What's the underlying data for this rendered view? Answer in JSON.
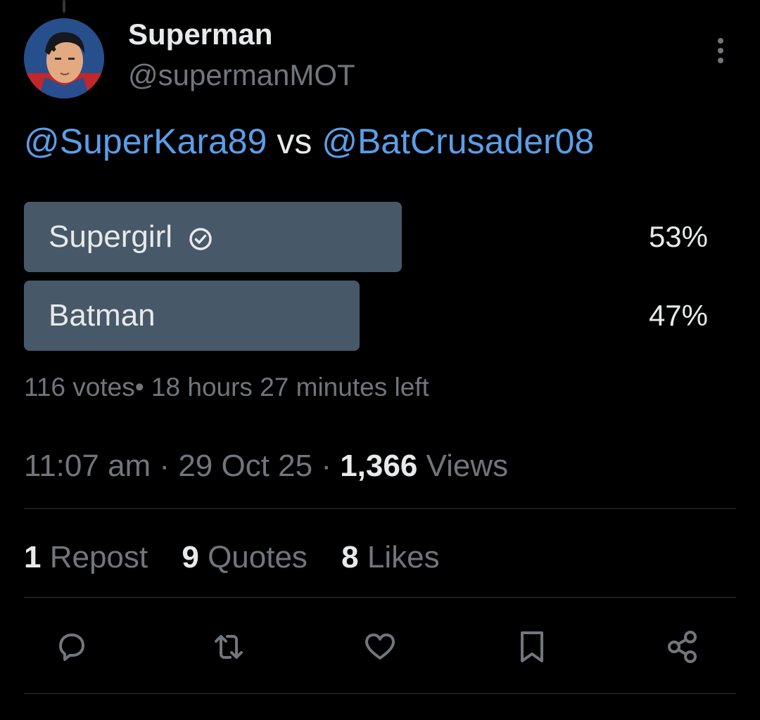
{
  "author": {
    "display_name": "Superman",
    "handle": "@supermanMOT"
  },
  "tweet": {
    "mention_1": "@SuperKara89",
    "connector": " vs ",
    "mention_2": "@BatCrusader08"
  },
  "poll": {
    "options": [
      {
        "label": "Supergirl",
        "percent_text": "53%",
        "fraction": 0.53,
        "selected": true
      },
      {
        "label": "Batman",
        "percent_text": "47%",
        "fraction": 0.47,
        "selected": false
      }
    ],
    "votes_text": "116 votes",
    "time_left_text": "• 18 hours 27 minutes left"
  },
  "meta": {
    "time": "11:07 am",
    "separator": " · ",
    "date": "29 Oct 25",
    "views_count": "1,366",
    "views_label": " Views"
  },
  "stats": {
    "reposts_count": "1",
    "reposts_label": " Repost",
    "quotes_count": "9",
    "quotes_label": " Quotes",
    "likes_count": "8",
    "likes_label": " Likes"
  },
  "icons": {
    "more": "more-vertical-icon",
    "reply": "reply-icon",
    "repost": "repost-icon",
    "like": "heart-icon",
    "bookmark": "bookmark-icon",
    "share": "share-icon",
    "check": "check-circle-icon"
  },
  "colors": {
    "background": "#000000",
    "mention": "#5a9ee8",
    "poll_bar": "#475868",
    "muted_text": "#71767b",
    "primary_text": "#e7e9ea"
  }
}
